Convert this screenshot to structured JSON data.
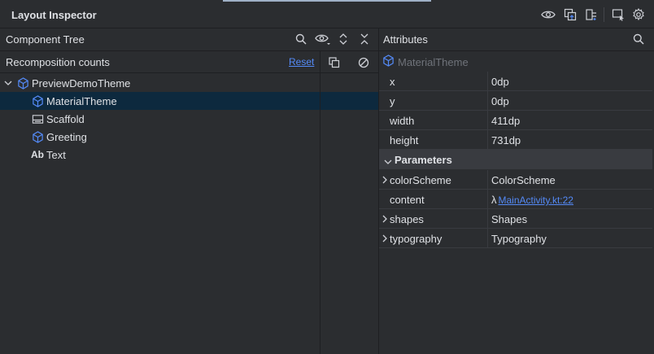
{
  "window": {
    "title": "Layout Inspector"
  },
  "component_tree": {
    "title": "Component Tree",
    "recomposition_label": "Recomposition counts",
    "reset_label": "Reset",
    "nodes": [
      {
        "label": "PreviewDemoTheme",
        "icon": "compose-cube-icon",
        "expanded": true,
        "selected": false
      },
      {
        "label": "MaterialTheme",
        "icon": "compose-cube-icon",
        "selected": true
      },
      {
        "label": "Scaffold",
        "icon": "scaffold-icon",
        "selected": false
      },
      {
        "label": "Greeting",
        "icon": "compose-cube-icon",
        "selected": false
      },
      {
        "label": "Text",
        "icon_text": "Ab",
        "selected": false
      }
    ]
  },
  "attributes": {
    "title": "Attributes",
    "node_label": "MaterialTheme",
    "dimensions": [
      {
        "key": "x",
        "value": "0dp"
      },
      {
        "key": "y",
        "value": "0dp"
      },
      {
        "key": "width",
        "value": "411dp"
      },
      {
        "key": "height",
        "value": "731dp"
      }
    ],
    "section_title": "Parameters",
    "parameters": [
      {
        "key": "colorScheme",
        "value": "ColorScheme",
        "expandable": true
      },
      {
        "key": "content",
        "lambda": "λ",
        "link": "MainActivity.kt:22",
        "expandable": false
      },
      {
        "key": "shapes",
        "value": "Shapes",
        "expandable": true
      },
      {
        "key": "typography",
        "value": "Typography",
        "expandable": true
      }
    ]
  },
  "colors": {
    "background": "#2b2d30",
    "selection": "#0d293e",
    "link": "#548af7",
    "icon_blue": "#548af7",
    "text": "#dfe1e5"
  }
}
